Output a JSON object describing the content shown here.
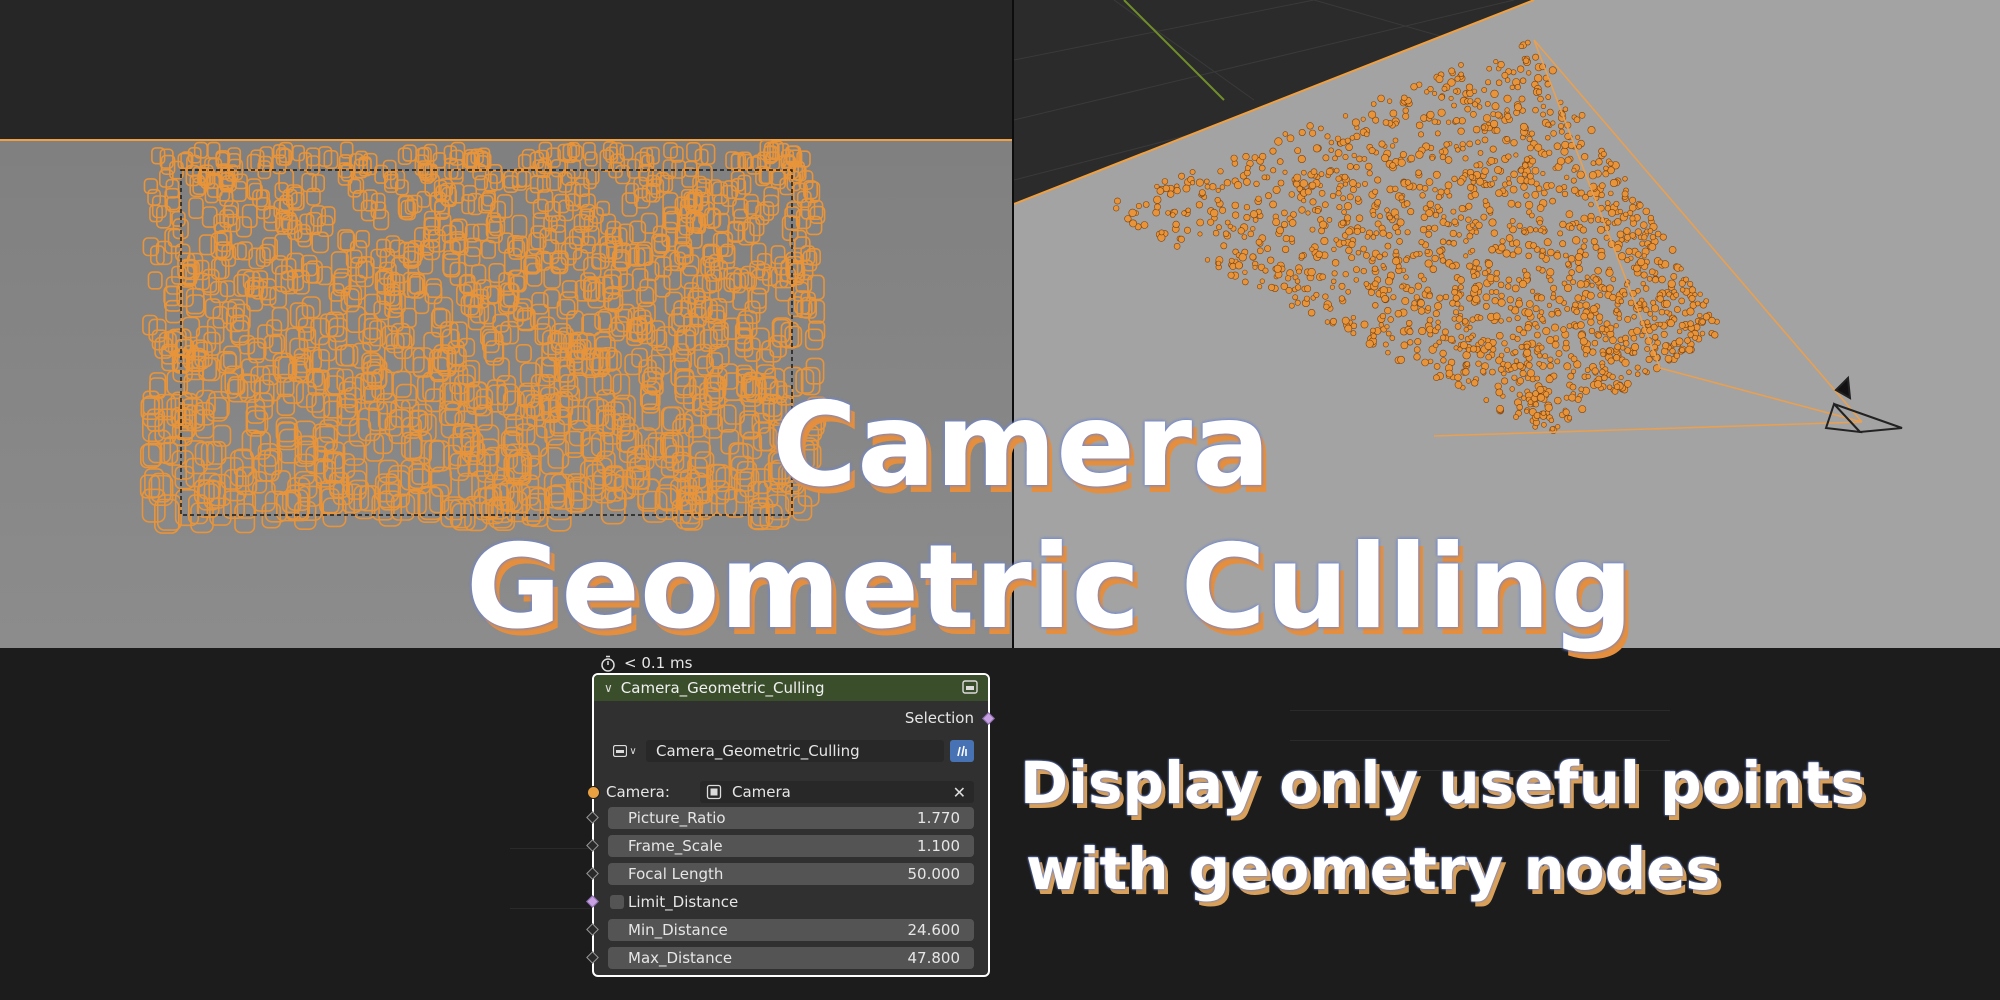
{
  "title": {
    "line1": "Camera",
    "line2": "Geometric Culling"
  },
  "subtitle": {
    "line1": "Display only useful points",
    "line2": "with geometry nodes"
  },
  "node": {
    "timing": "< 0.1 ms",
    "header_title": "Camera_Geometric_Culling",
    "output_label": "Selection",
    "group_name": "Camera_Geometric_Culling",
    "camera_label": "Camera:",
    "camera_value": "Camera",
    "inputs": [
      {
        "label": "Picture_Ratio",
        "value": "1.770"
      },
      {
        "label": "Frame_Scale",
        "value": "1.100"
      },
      {
        "label": "Focal Length",
        "value": "50.000"
      },
      {
        "label": "Min_Distance",
        "value": "24.600"
      },
      {
        "label": "Max_Distance",
        "value": "47.800"
      }
    ],
    "checkbox_label": "Limit_Distance",
    "checkbox_checked": false
  },
  "colors": {
    "node_header": "#3b4e2c",
    "point_orange": "#e8943a",
    "selection_outline": "#f5a33a",
    "title_shadow": "#e58f3e",
    "title_outline": "#6d86d6"
  },
  "icons": [
    "stopwatch-icon",
    "node-group-icon",
    "fake-user-icon",
    "camera-object-icon",
    "clear-icon",
    "chevron-down-icon"
  ]
}
